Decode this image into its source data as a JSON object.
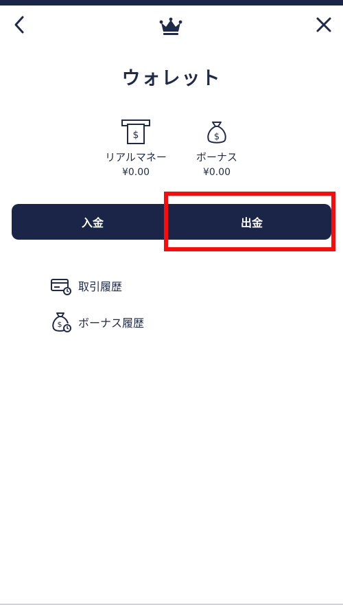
{
  "header": {
    "back_icon": "chevron-left-icon",
    "logo_icon": "crown-icon",
    "close_icon": "close-icon"
  },
  "page": {
    "title": "ウォレット"
  },
  "balances": [
    {
      "icon": "atm-money-icon",
      "label": "リアルマネー",
      "amount": "¥0.00"
    },
    {
      "icon": "money-bag-icon",
      "label": "ボーナス",
      "amount": "¥0.00"
    }
  ],
  "actions": {
    "deposit_label": "入金",
    "withdraw_label": "出金"
  },
  "menu": [
    {
      "icon": "card-history-icon",
      "label": "取引履歴"
    },
    {
      "icon": "bag-history-icon",
      "label": "ボーナス履歴"
    }
  ],
  "colors": {
    "primary": "#1b2547",
    "text": "#1f2a4b",
    "highlight": "#ff0a0a",
    "background": "#ffffff"
  }
}
